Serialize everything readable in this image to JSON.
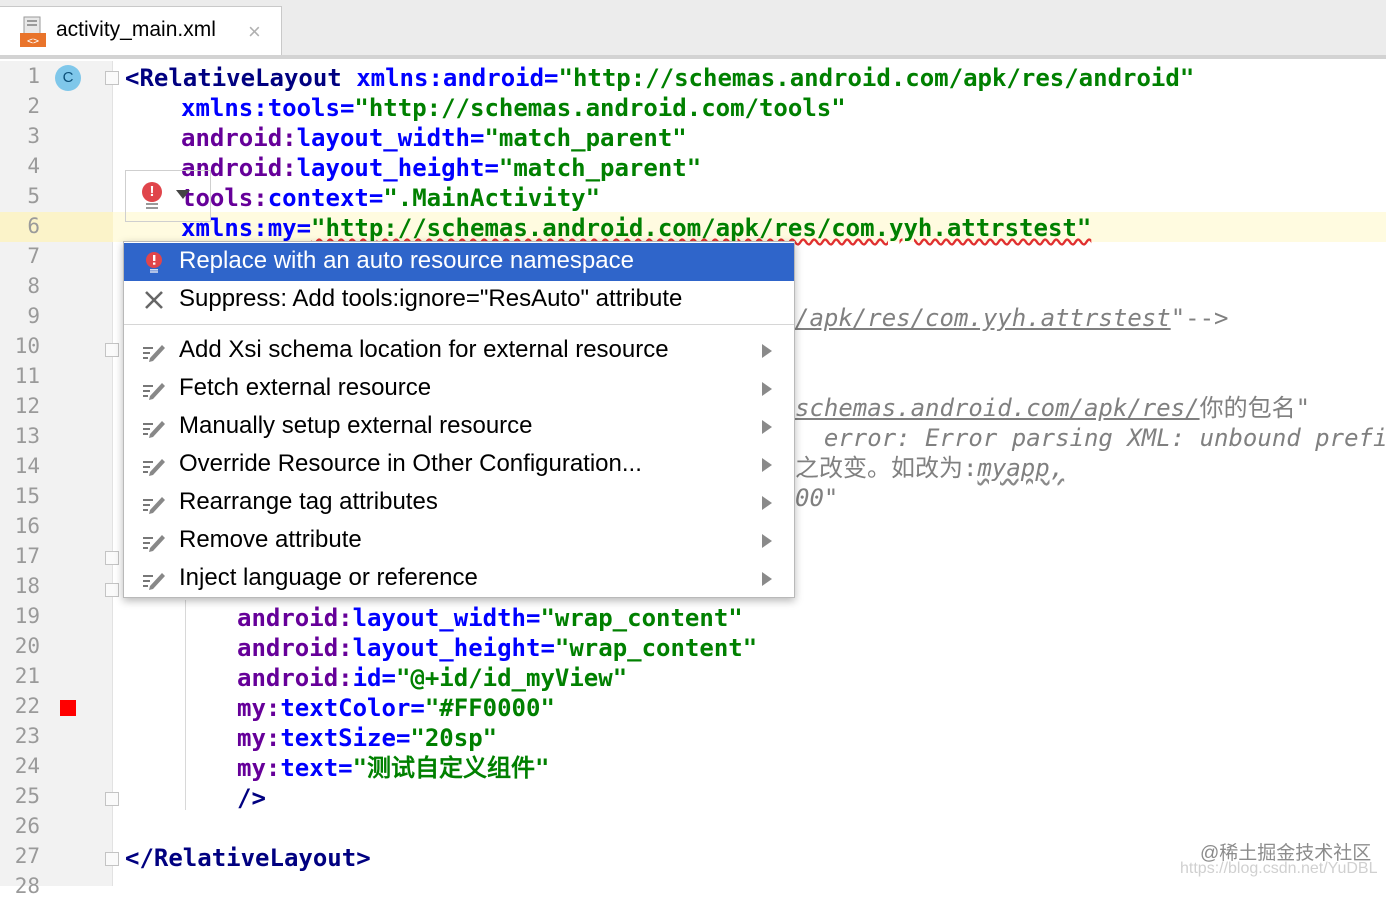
{
  "tab": {
    "filename": "activity_main.xml",
    "close_glyph": "×"
  },
  "line_numbers": [
    "1",
    "2",
    "3",
    "4",
    "5",
    "6",
    "7",
    "8",
    "9",
    "10",
    "11",
    "12",
    "13",
    "14",
    "15",
    "16",
    "17",
    "18",
    "19",
    "20",
    "21",
    "22",
    "23",
    "24",
    "25",
    "26",
    "27",
    "28"
  ],
  "gutter_icons": {
    "class_badge": "C"
  },
  "code": {
    "l1": {
      "tag_open": "<",
      "tag": "RelativeLayout",
      "attr": "xmlns:android",
      "eq": "=",
      "val": "\"http://schemas.android.com/apk/res/android\""
    },
    "l2": {
      "attr": "xmlns:tools",
      "eq": "=",
      "val": "\"http://schemas.android.com/tools\""
    },
    "l3": {
      "ns": "android:",
      "attr": "layout_width",
      "eq": "=",
      "val": "\"match_parent\""
    },
    "l4": {
      "ns": "android:",
      "attr": "layout_height",
      "eq": "=",
      "val": "\"match_parent\""
    },
    "l5": {
      "ns": "tools:",
      "attr": "context",
      "eq": "=",
      "val": "\".MainActivity\""
    },
    "l6": {
      "attr": "xmlns:my",
      "eq": "=",
      "val": "\"http://schemas.android.com/apk/res/com.yyh.attrstest\""
    },
    "l9": {
      "frag": "/apk/res/com.yyh.attrstest",
      "tail": "\"-->"
    },
    "l12": {
      "frag": "schemas.android.com/apk/res/",
      "tail": "你的包名\""
    },
    "l13": {
      "frag": "  error: Error parsing XML: unbound prefix"
    },
    "l14": {
      "frag": "之改变。如改为:",
      "tail": "myapp,"
    },
    "l15": {
      "frag": "00\""
    },
    "l19": {
      "ns": "android:",
      "attr": "layout_width",
      "eq": "=",
      "val": "\"wrap_content\""
    },
    "l20": {
      "ns": "android:",
      "attr": "layout_height",
      "eq": "=",
      "val": "\"wrap_content\""
    },
    "l21": {
      "ns": "android:",
      "attr": "id",
      "eq": "=",
      "val": "\"@+id/id_myView\""
    },
    "l22": {
      "ns": "my:",
      "attr": "textColor",
      "eq": "=",
      "val": "\"#FF0000\""
    },
    "l23": {
      "ns": "my:",
      "attr": "textSize",
      "eq": "=",
      "val": "\"20sp\""
    },
    "l24": {
      "ns": "my:",
      "attr": "text",
      "eq": "=",
      "val": "\"测试自定义组件\""
    },
    "l25": {
      "close": "/>"
    },
    "l27": {
      "tag_close": "</",
      "tag": "RelativeLayout",
      "end": ">"
    }
  },
  "popup": {
    "items": [
      {
        "label": "Replace with an auto resource namespace",
        "icon": "error-bulb-icon",
        "submenu": false
      },
      {
        "label": "Suppress: Add tools:ignore=\"ResAuto\" attribute",
        "icon": "close-icon",
        "submenu": false
      },
      {
        "label": "Add Xsi schema location for external resource",
        "icon": "intention-pencil-icon",
        "submenu": true
      },
      {
        "label": "Fetch external resource",
        "icon": "intention-pencil-icon",
        "submenu": true
      },
      {
        "label": "Manually setup external resource",
        "icon": "intention-pencil-icon",
        "submenu": true
      },
      {
        "label": "Override Resource in Other Configuration...",
        "icon": "intention-pencil-icon",
        "submenu": true
      },
      {
        "label": "Rearrange tag attributes",
        "icon": "intention-pencil-icon",
        "submenu": true
      },
      {
        "label": "Remove attribute",
        "icon": "intention-pencil-icon",
        "submenu": true
      },
      {
        "label": "Inject language or reference",
        "icon": "intention-pencil-icon",
        "submenu": true
      }
    ]
  },
  "watermark": {
    "text": "@稀土掘金技术社区",
    "url": "https://blog.csdn.net/YuDBL"
  },
  "colors": {
    "selection": "#2f65ca",
    "tag": "#000080",
    "attr": "#660099",
    "string": "#008000",
    "breakpoint": "#ff0000"
  }
}
